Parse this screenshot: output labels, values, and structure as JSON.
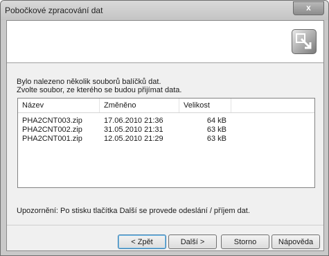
{
  "window": {
    "title": "Pobočkové zpracování dat",
    "close_label": "x"
  },
  "header": {
    "logo_icon": "wizard-arrow-icon"
  },
  "intro": {
    "line1": "Bylo nalezeno několik souborů balíčků dat.",
    "line2": "Zvolte soubor, ze kterého se budou přijímat data."
  },
  "list": {
    "columns": [
      "Název",
      "Změněno",
      "Velikost"
    ],
    "rows": [
      {
        "name": "PHA2CNT003.zip",
        "modified": "17.06.2010 21:36",
        "size": "64 kB"
      },
      {
        "name": "PHA2CNT002.zip",
        "modified": "31.05.2010 21:31",
        "size": "63 kB"
      },
      {
        "name": "PHA2CNT001.zip",
        "modified": "12.05.2010 21:29",
        "size": "63 kB"
      }
    ]
  },
  "notice": "Upozornění: Po stisku tlačítka Další se provede odeslání / příjem dat.",
  "buttons": {
    "back": "< Zpět",
    "next": "Další >",
    "cancel": "Storno",
    "help": "Nápověda"
  }
}
